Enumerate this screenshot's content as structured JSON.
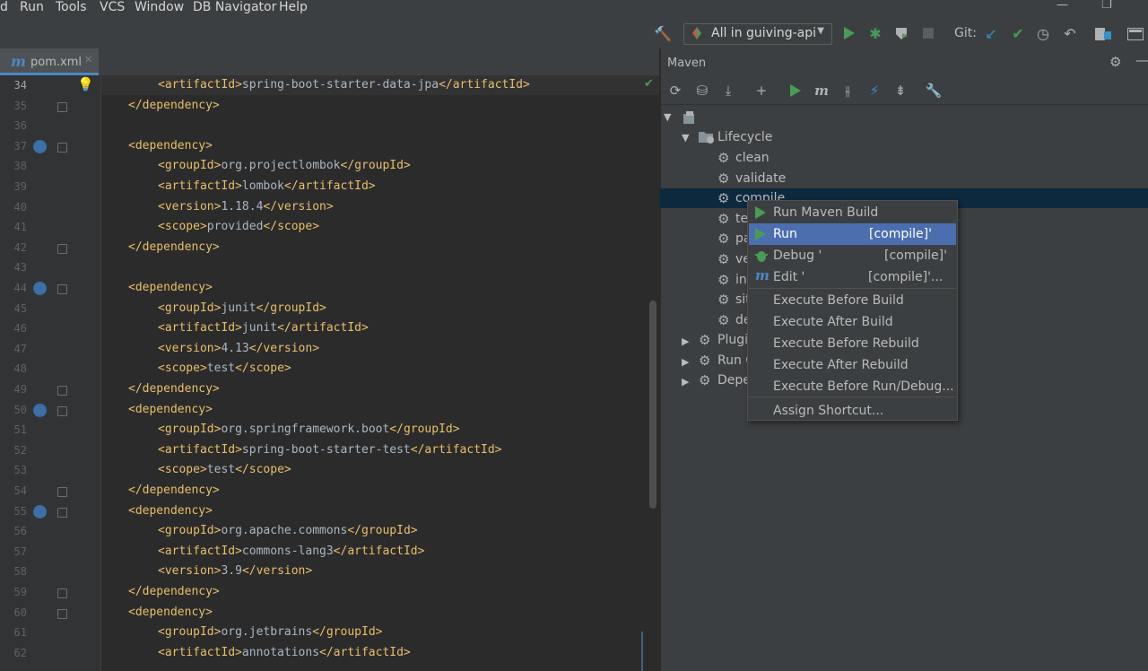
{
  "menu": {
    "items": [
      "d",
      "Run",
      "Tools",
      "VCS",
      "Window",
      "DB Navigator",
      "Help"
    ]
  },
  "window_controls": {
    "minimize": "—",
    "restore": "❐"
  },
  "toolbar": {
    "run_config": "All in guiving-api",
    "git_label": "Git:",
    "accent_green": "#499c54"
  },
  "editor": {
    "tab_icon": "m",
    "tab_name": "pom.xml",
    "tab_close": "✕",
    "lines": [
      {
        "n": "34",
        "indent": 2,
        "parts": [
          [
            "tag",
            "<artifactId>"
          ],
          [
            "txt",
            "spring-boot-starter-data-jpa"
          ],
          [
            "tag",
            "</artifactId>"
          ]
        ]
      },
      {
        "n": "35",
        "indent": 1,
        "parts": [
          [
            "tag",
            "</dependency>"
          ]
        ]
      },
      {
        "n": "36",
        "indent": 0,
        "parts": []
      },
      {
        "n": "37",
        "indent": 1,
        "parts": [
          [
            "tag",
            "<dependency>"
          ]
        ]
      },
      {
        "n": "38",
        "indent": 2,
        "parts": [
          [
            "tag",
            "<groupId>"
          ],
          [
            "txt",
            "org.projectlombok"
          ],
          [
            "tag",
            "</groupId>"
          ]
        ]
      },
      {
        "n": "39",
        "indent": 2,
        "parts": [
          [
            "tag",
            "<artifactId>"
          ],
          [
            "txt",
            "lombok"
          ],
          [
            "tag",
            "</artifactId>"
          ]
        ]
      },
      {
        "n": "40",
        "indent": 2,
        "parts": [
          [
            "tag",
            "<version>"
          ],
          [
            "txt",
            "1.18.4"
          ],
          [
            "tag",
            "</version>"
          ]
        ]
      },
      {
        "n": "41",
        "indent": 2,
        "parts": [
          [
            "tag",
            "<scope>"
          ],
          [
            "txt",
            "provided"
          ],
          [
            "tag",
            "</scope>"
          ]
        ]
      },
      {
        "n": "42",
        "indent": 1,
        "parts": [
          [
            "tag",
            "</dependency>"
          ]
        ]
      },
      {
        "n": "43",
        "indent": 0,
        "parts": []
      },
      {
        "n": "44",
        "indent": 1,
        "parts": [
          [
            "tag",
            "<dependency>"
          ]
        ]
      },
      {
        "n": "45",
        "indent": 2,
        "parts": [
          [
            "tag",
            "<groupId>"
          ],
          [
            "txt",
            "junit"
          ],
          [
            "tag",
            "</groupId>"
          ]
        ]
      },
      {
        "n": "46",
        "indent": 2,
        "parts": [
          [
            "tag",
            "<artifactId>"
          ],
          [
            "txt",
            "junit"
          ],
          [
            "tag",
            "</artifactId>"
          ]
        ]
      },
      {
        "n": "47",
        "indent": 2,
        "parts": [
          [
            "tag",
            "<version>"
          ],
          [
            "txt",
            "4.13"
          ],
          [
            "tag",
            "</version>"
          ]
        ]
      },
      {
        "n": "48",
        "indent": 2,
        "parts": [
          [
            "tag",
            "<scope>"
          ],
          [
            "txt",
            "test"
          ],
          [
            "tag",
            "</scope>"
          ]
        ]
      },
      {
        "n": "49",
        "indent": 1,
        "parts": [
          [
            "tag",
            "</dependency>"
          ]
        ]
      },
      {
        "n": "50",
        "indent": 1,
        "parts": [
          [
            "tag",
            "<dependency>"
          ]
        ]
      },
      {
        "n": "51",
        "indent": 2,
        "parts": [
          [
            "tag",
            "<groupId>"
          ],
          [
            "txt",
            "org.springframework.boot"
          ],
          [
            "tag",
            "</groupId>"
          ]
        ]
      },
      {
        "n": "52",
        "indent": 2,
        "parts": [
          [
            "tag",
            "<artifactId>"
          ],
          [
            "txt",
            "spring-boot-starter-test"
          ],
          [
            "tag",
            "</artifactId>"
          ]
        ]
      },
      {
        "n": "53",
        "indent": 2,
        "parts": [
          [
            "tag",
            "<scope>"
          ],
          [
            "txt",
            "test"
          ],
          [
            "tag",
            "</scope>"
          ]
        ]
      },
      {
        "n": "54",
        "indent": 1,
        "parts": [
          [
            "tag",
            "</dependency>"
          ]
        ]
      },
      {
        "n": "55",
        "indent": 1,
        "parts": [
          [
            "tag",
            "<dependency>"
          ]
        ]
      },
      {
        "n": "56",
        "indent": 2,
        "parts": [
          [
            "tag",
            "<groupId>"
          ],
          [
            "txt",
            "org.apache.commons"
          ],
          [
            "tag",
            "</groupId>"
          ]
        ]
      },
      {
        "n": "57",
        "indent": 2,
        "parts": [
          [
            "tag",
            "<artifactId>"
          ],
          [
            "txt",
            "commons-lang3"
          ],
          [
            "tag",
            "</artifactId>"
          ]
        ]
      },
      {
        "n": "58",
        "indent": 2,
        "parts": [
          [
            "tag",
            "<version>"
          ],
          [
            "txt",
            "3.9"
          ],
          [
            "tag",
            "</version>"
          ]
        ]
      },
      {
        "n": "59",
        "indent": 1,
        "parts": [
          [
            "tag",
            "</dependency>"
          ]
        ]
      },
      {
        "n": "60",
        "indent": 1,
        "parts": [
          [
            "tag",
            "<dependency>"
          ]
        ]
      },
      {
        "n": "61",
        "indent": 2,
        "parts": [
          [
            "tag",
            "<groupId>"
          ],
          [
            "txt",
            "org.jetbrains"
          ],
          [
            "tag",
            "</groupId>"
          ]
        ]
      },
      {
        "n": "62",
        "indent": 2,
        "parts": [
          [
            "tag",
            "<artifactId>"
          ],
          [
            "txt",
            "annotations"
          ],
          [
            "tag",
            "</artifactId>"
          ]
        ]
      }
    ],
    "gutter_icon_lines": [
      "37",
      "44",
      "50",
      "55"
    ],
    "fold_lines": [
      "35",
      "37",
      "42",
      "44",
      "49",
      "50",
      "54",
      "55",
      "59",
      "60"
    ]
  },
  "maven": {
    "title": "Maven",
    "tree": {
      "lifecycle_label": "Lifecycle",
      "lifecycle_items": [
        "clean",
        "validate",
        "compile",
        "te",
        "pa",
        "ve",
        "in",
        "sit",
        "de"
      ],
      "groups": [
        "Plugi",
        "Run C",
        "Depe"
      ]
    }
  },
  "context_menu": {
    "items": [
      {
        "label": "Run Maven Build",
        "suffix": "",
        "icon": "run-icon"
      },
      {
        "label": "Run",
        "suffix": "[compile]'",
        "icon": "run-icon",
        "selected": true
      },
      {
        "label": "Debug '",
        "suffix": "[compile]'",
        "icon": "debug-icon"
      },
      {
        "label": "Edit '",
        "suffix": "[compile]'...",
        "icon": "maven-icon"
      },
      {
        "label": "Execute Before Build",
        "suffix": ""
      },
      {
        "label": "Execute After Build",
        "suffix": ""
      },
      {
        "label": "Execute Before Rebuild",
        "suffix": ""
      },
      {
        "label": "Execute After Rebuild",
        "suffix": ""
      },
      {
        "label": "Execute Before Run/Debug...",
        "suffix": ""
      },
      {
        "label": "Assign Shortcut...",
        "suffix": ""
      }
    ]
  }
}
